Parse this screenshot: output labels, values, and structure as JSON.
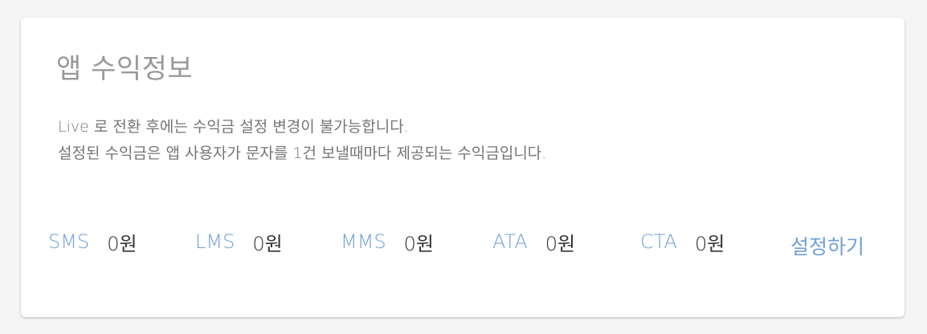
{
  "card": {
    "title": "앱 수익정보",
    "description_lines": [
      "Live 로 전환 후에는 수익금 설정 변경이 불가능합니다.",
      "설정된 수익금은 앱 사용자가 문자를 1건 보낼때마다 제공되는 수익금입니다."
    ],
    "rates": [
      {
        "label": "SMS",
        "value": "0원"
      },
      {
        "label": "LMS",
        "value": "0원"
      },
      {
        "label": "MMS",
        "value": "0원"
      },
      {
        "label": "ATA",
        "value": "0원"
      },
      {
        "label": "CTA",
        "value": "0원"
      }
    ],
    "settings_label": "설정하기"
  },
  "colors": {
    "background": "#f5f5f5",
    "card": "#ffffff",
    "title": "#999999",
    "description": "#757575",
    "accent": "#6f9fd8",
    "value": "#333333"
  }
}
